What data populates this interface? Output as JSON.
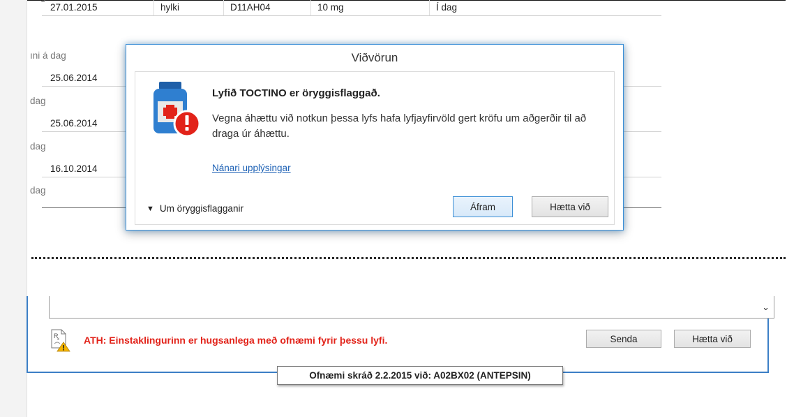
{
  "list": {
    "items": [
      {
        "date": "27.01.2015",
        "form": "hylki",
        "atc": "D11AH04",
        "dose": "10 mg",
        "when": "Í dag"
      },
      {
        "date": "25.06.2014"
      },
      {
        "date": "25.06.2014"
      },
      {
        "date": "16.10.2014"
      }
    ],
    "dose_lines": [
      "ıni á dag",
      "dag",
      "dag",
      "dag"
    ],
    "top_fragment": "dag"
  },
  "dialog": {
    "title": "Viðvörun",
    "heading": "Lyfið TOCTINO er öryggisflaggað.",
    "description": "Vegna áhættu við notkun þessa lyfs hafa lyfjayfirvöld gert kröfu um aðgerðir til að draga úr áhættu.",
    "link": "Nánari upplýsingar",
    "expander_label": "Um öryggisflagganir",
    "continue_label": "Áfram",
    "cancel_label": "Hætta við"
  },
  "bottom_panel": {
    "warning_text": "ATH: Einstaklingurinn er hugsanlega með ofnæmi fyrir þessu lyfi.",
    "send_label": "Senda",
    "cancel_label": "Hætta við",
    "combo_icon": "chevron-down-icon"
  },
  "tooltip": {
    "text": "Ofnæmi skráð 2.2.2015 við: A02BX02 (ANTEPSIN)"
  },
  "colors": {
    "accent": "#3c8fd6",
    "warning_text": "#e2231a",
    "link": "#1a5fb4"
  }
}
